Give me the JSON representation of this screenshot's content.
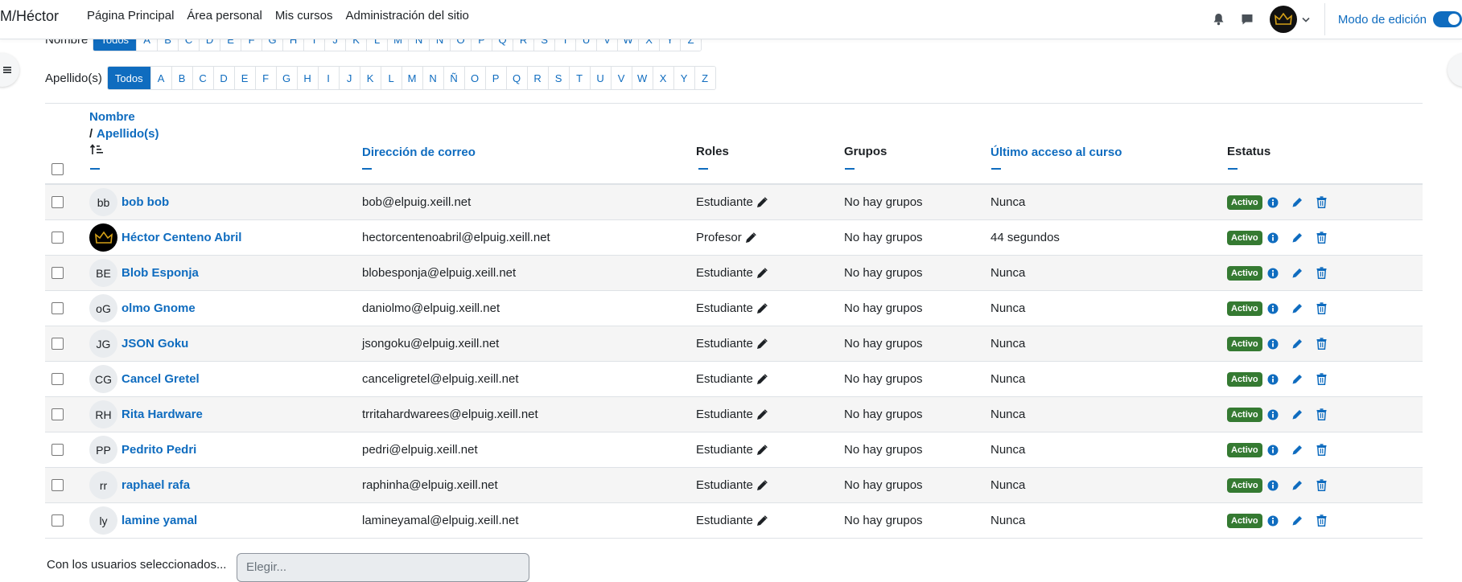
{
  "brand": "M/Héctor",
  "nav": {
    "links": [
      "Página Principal",
      "Área personal",
      "Mis cursos",
      "Administración del sitio"
    ],
    "edit_mode_label": "Modo de edición"
  },
  "filters": {
    "first_name_label": "Nombre",
    "first_name_letters": [
      "Todos",
      "A",
      "B",
      "C",
      "D",
      "E",
      "F",
      "G",
      "H",
      "I",
      "J",
      "K",
      "L",
      "M",
      "N",
      "Ñ",
      "O",
      "P",
      "Q",
      "R",
      "S",
      "T",
      "U",
      "V",
      "W",
      "X",
      "Y",
      "Z"
    ],
    "last_name_label": "Apellido(s)",
    "last_name_letters": [
      "Todos",
      "A",
      "B",
      "C",
      "D",
      "E",
      "F",
      "G",
      "H",
      "I",
      "J",
      "K",
      "L",
      "M",
      "N",
      "Ñ",
      "O",
      "P",
      "Q",
      "R",
      "S",
      "T",
      "U",
      "V",
      "W",
      "X",
      "Y",
      "Z"
    ]
  },
  "table": {
    "headers": {
      "first_name": "Nombre",
      "separator": "/",
      "last_name": "Apellido(s)",
      "email": "Dirección de correo",
      "roles": "Roles",
      "groups": "Grupos",
      "last_access": "Último acceso al curso",
      "status": "Estatus"
    },
    "rows": [
      {
        "initials": "bb",
        "name": "bob bob",
        "email": "bob@elpuig.xeill.net",
        "role": "Estudiante",
        "groups": "No hay grupos",
        "last_access": "Nunca",
        "status": "Activo"
      },
      {
        "initials": "",
        "name": "Héctor Centeno Abril",
        "email": "hectorcentenoabril@elpuig.xeill.net",
        "role": "Profesor",
        "groups": "No hay grupos",
        "last_access": "44 segundos",
        "status": "Activo"
      },
      {
        "initials": "BE",
        "name": "Blob Esponja",
        "email": "blobesponja@elpuig.xeill.net",
        "role": "Estudiante",
        "groups": "No hay grupos",
        "last_access": "Nunca",
        "status": "Activo"
      },
      {
        "initials": "oG",
        "name": "olmo Gnome",
        "email": "daniolmo@elpuig.xeill.net",
        "role": "Estudiante",
        "groups": "No hay grupos",
        "last_access": "Nunca",
        "status": "Activo"
      },
      {
        "initials": "JG",
        "name": "JSON Goku",
        "email": "jsongoku@elpuig.xeill.net",
        "role": "Estudiante",
        "groups": "No hay grupos",
        "last_access": "Nunca",
        "status": "Activo"
      },
      {
        "initials": "CG",
        "name": "Cancel Gretel",
        "email": "canceligretel@elpuig.xeill.net",
        "role": "Estudiante",
        "groups": "No hay grupos",
        "last_access": "Nunca",
        "status": "Activo"
      },
      {
        "initials": "RH",
        "name": "Rita Hardware",
        "email": "trritahardwarees@elpuig.xeill.net",
        "role": "Estudiante",
        "groups": "No hay grupos",
        "last_access": "Nunca",
        "status": "Activo"
      },
      {
        "initials": "PP",
        "name": "Pedrito Pedri",
        "email": "pedri@elpuig.xeill.net",
        "role": "Estudiante",
        "groups": "No hay grupos",
        "last_access": "Nunca",
        "status": "Activo"
      },
      {
        "initials": "rr",
        "name": "raphael rafa",
        "email": "raphinha@elpuig.xeill.net",
        "role": "Estudiante",
        "groups": "No hay grupos",
        "last_access": "Nunca",
        "status": "Activo"
      },
      {
        "initials": "ly",
        "name": "lamine yamal",
        "email": "lamineyamal@elpuig.xeill.net",
        "role": "Estudiante",
        "groups": "No hay grupos",
        "last_access": "Nunca",
        "status": "Activo"
      }
    ]
  },
  "bulk": {
    "label": "Con los usuarios seleccionados...",
    "select_value": "Elegir..."
  },
  "colors": {
    "accent": "#0f6cbf",
    "active_badge": "#357a32"
  }
}
